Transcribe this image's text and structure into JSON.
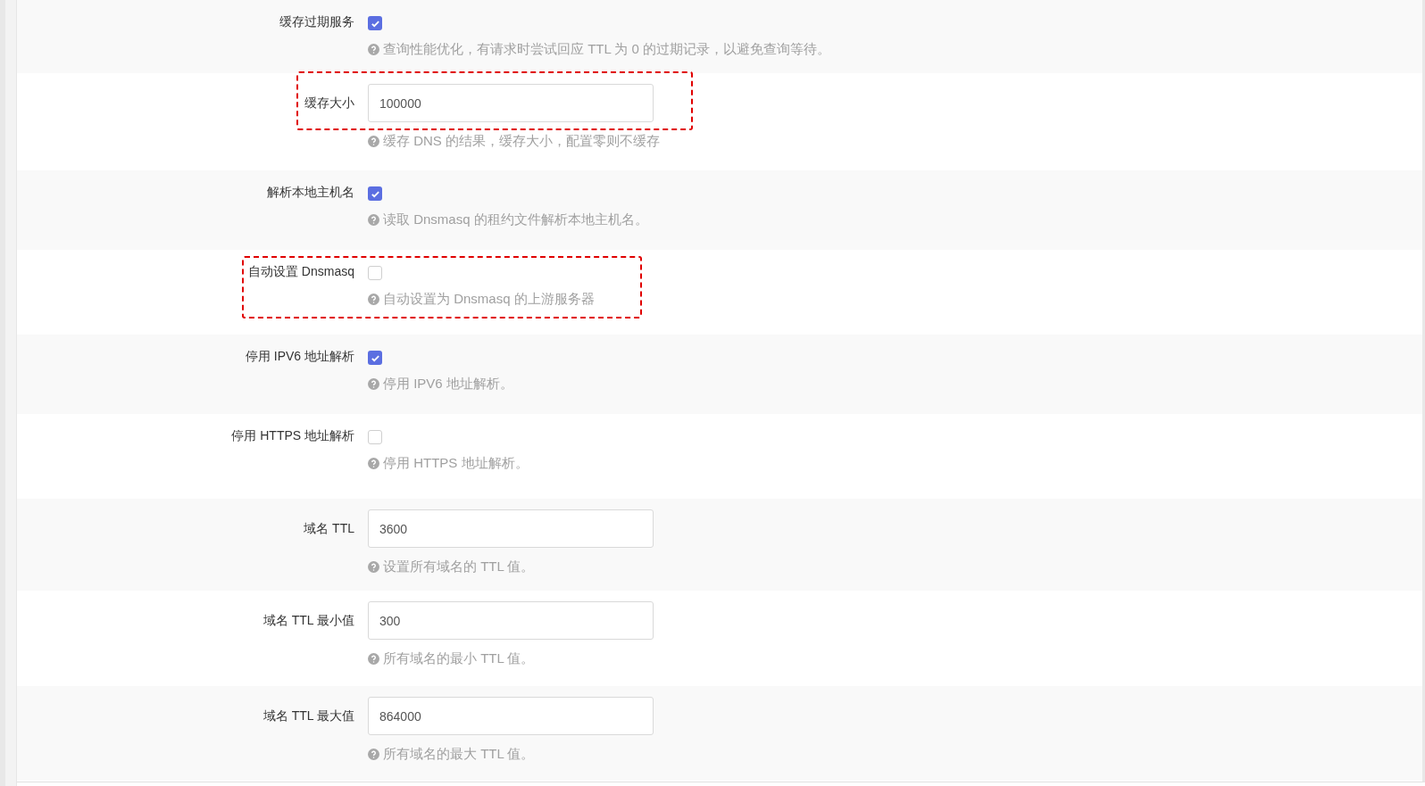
{
  "rows": [
    {
      "kind": "checkbox",
      "label": "缓存过期服务",
      "checked": true,
      "help": "查询性能优化，有请求时尝试回应 TTL 为 0 的过期记录，以避免查询等待。",
      "highlighted": false
    },
    {
      "kind": "input",
      "label": "缓存大小",
      "value": "100000",
      "help": "缓存 DNS 的结果，缓存大小，配置零则不缓存",
      "highlighted": true
    },
    {
      "kind": "checkbox",
      "label": "解析本地主机名",
      "checked": true,
      "help": "读取 Dnsmasq 的租约文件解析本地主机名。",
      "highlighted": false
    },
    {
      "kind": "checkbox",
      "label": "自动设置 Dnsmasq",
      "checked": false,
      "help": "自动设置为 Dnsmasq 的上游服务器",
      "highlighted": true
    },
    {
      "kind": "checkbox",
      "label": "停用 IPV6 地址解析",
      "checked": true,
      "help": "停用 IPV6 地址解析。",
      "highlighted": false
    },
    {
      "kind": "checkbox",
      "label": "停用 HTTPS 地址解析",
      "checked": false,
      "help": "停用 HTTPS 地址解析。",
      "highlighted": false
    },
    {
      "kind": "input",
      "label": "域名 TTL",
      "value": "3600",
      "help": "设置所有域名的 TTL 值。",
      "highlighted": false
    },
    {
      "kind": "input",
      "label": "域名 TTL 最小值",
      "value": "300",
      "help": "所有域名的最小 TTL 值。",
      "highlighted": false
    },
    {
      "kind": "input",
      "label": "域名 TTL 最大值",
      "value": "864000",
      "help": "所有域名的最大 TTL 值。",
      "highlighted": false
    }
  ]
}
